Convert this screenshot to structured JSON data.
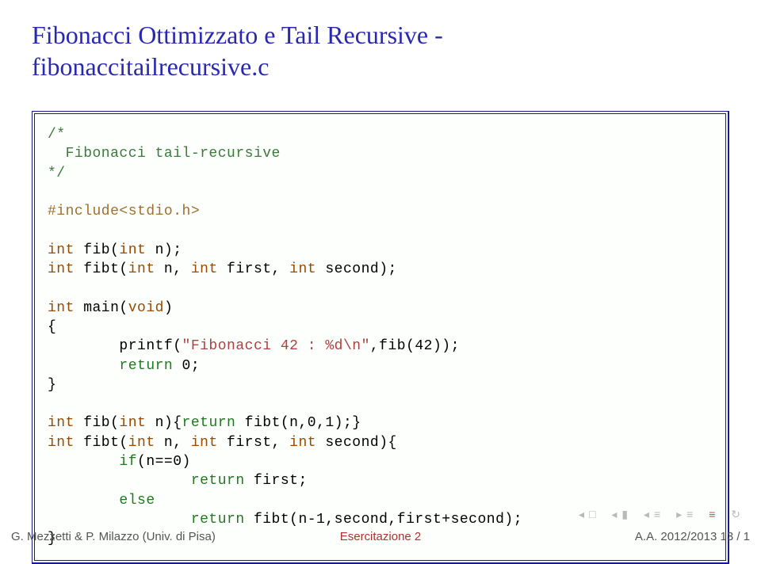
{
  "title_line1": "Fibonacci Ottimizzato e Tail Recursive -",
  "title_line2": "fibonaccitailrecursive.c",
  "code": {
    "c1": "/*",
    "c2": "  Fibonacci tail-recursive",
    "c3": "*/",
    "include": "#include<stdio.h>",
    "decl1_a": "int",
    "decl1_b": " fib(",
    "decl1_c": "int",
    "decl1_d": " n);",
    "decl2_a": "int",
    "decl2_b": " fibt(",
    "decl2_c": "int",
    "decl2_d": " n, ",
    "decl2_e": "int",
    "decl2_f": " first, ",
    "decl2_g": "int",
    "decl2_h": " second);",
    "main_a": "int",
    "main_b": " main(",
    "main_c": "void",
    "main_d": ")",
    "brace_open": "{",
    "printf_a": "        printf(",
    "printf_str": "\"Fibonacci 42 : %d\\n\"",
    "printf_b": ",fib(42));",
    "ret0_a": "        ",
    "ret0_b": "return",
    "ret0_c": " 0;",
    "brace_close": "}",
    "fib_a": "int",
    "fib_b": " fib(",
    "fib_c": "int",
    "fib_d": " n){",
    "fib_e": "return",
    "fib_f": " fibt(n,0,1);}",
    "fibt_a": "int",
    "fibt_b": " fibt(",
    "fibt_c": "int",
    "fibt_d": " n, ",
    "fibt_e": "int",
    "fibt_f": " first, ",
    "fibt_g": "int",
    "fibt_h": " second){",
    "if_a": "        ",
    "if_b": "if",
    "if_c": "(n==0)",
    "retf_a": "                ",
    "retf_b": "return",
    "retf_c": " first;",
    "else_a": "        ",
    "else_b": "else",
    "rett_a": "                ",
    "rett_b": "return",
    "rett_c": " fibt(n-1,second,first+second);",
    "brace_close2": "}"
  },
  "footer": {
    "left": "G. Mezzetti & P. Milazzo (Univ. di Pisa)",
    "mid": "Esercitazione 2",
    "right": "A.A. 2012/2013     13 / 1"
  },
  "colors": {
    "title": "#2828b0",
    "accent": "#b03030"
  }
}
